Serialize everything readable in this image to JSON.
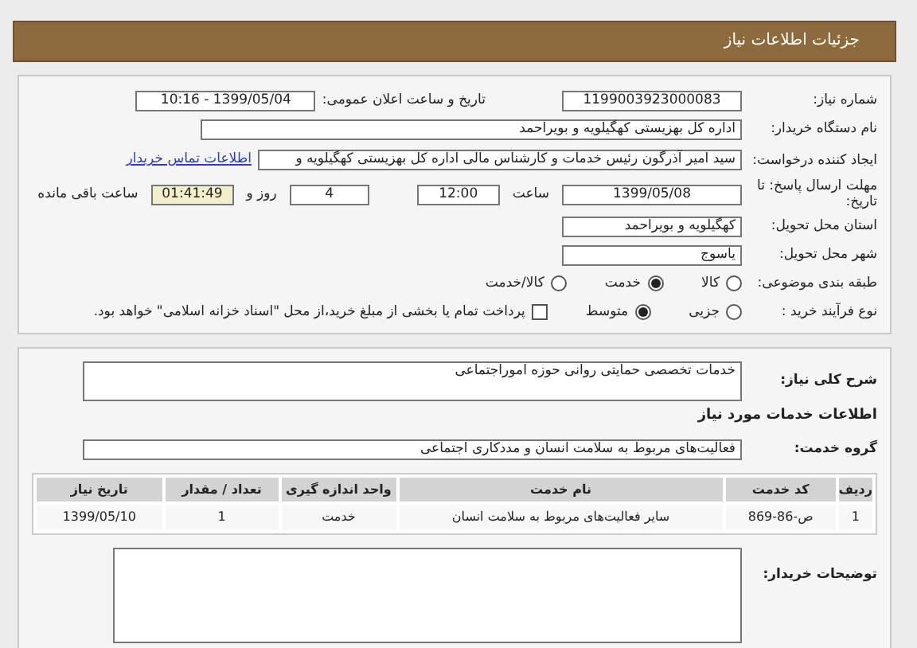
{
  "header": {
    "title": "جزئیات اطلاعات نیاز"
  },
  "need_number": {
    "label": "شماره نیاز:",
    "value": "1199003923000083"
  },
  "announce": {
    "label": "تاریخ و ساعت اعلان عمومی:",
    "value": "1399/05/04 - 10:16"
  },
  "buyer": {
    "label": "نام دستگاه خریدار:",
    "value": "اداره کل بهزیستی کهگیلویه و بویراحمد"
  },
  "creator": {
    "label": "ایجاد کننده درخواست:",
    "value": "سید امیر آذرگون رئیس خدمات و کارشناس مالی اداره کل بهزیستی کهگیلویه و",
    "link": "اطلاعات تماس خریدار"
  },
  "deadline": {
    "label": "مهلت ارسال پاسخ: تا تاریخ:",
    "date": "1399/05/08",
    "time_label": "ساعت",
    "time": "12:00",
    "days": "4",
    "days_label": "روز و",
    "remaining": "01:41:49",
    "remaining_label": "ساعت باقی مانده"
  },
  "province": {
    "label": "استان محل تحویل:",
    "value": "کهگیلویه و بویراحمد"
  },
  "city": {
    "label": "شهر محل تحویل:",
    "value": "یاسوج"
  },
  "category": {
    "label": "طبقه بندی موضوعی:",
    "options": [
      {
        "label": "کالا",
        "selected": false
      },
      {
        "label": "خدمت",
        "selected": true
      },
      {
        "label": "کالا/خدمت",
        "selected": false
      }
    ]
  },
  "purchase_type": {
    "label": "نوع فرآیند خرید :",
    "options": [
      {
        "label": "جزیی",
        "selected": false
      },
      {
        "label": "متوسط",
        "selected": true
      }
    ],
    "treasury": {
      "label": "پرداخت تمام یا بخشی از مبلغ خرید،از محل \"اسناد خزانه اسلامی\" خواهد بود.",
      "checked": false
    }
  },
  "description": {
    "label": "شرح کلی نیاز:",
    "value": "خدمات تخصصی حمایتی روانی حوزه اموراجتماعی"
  },
  "services_heading": "اطلاعات خدمات مورد نیاز",
  "service_group": {
    "label": "گروه خدمت:",
    "value": "فعالیت‌های مربوط به سلامت انسان و مددکاری اجتماعی"
  },
  "table": {
    "columns": [
      "ردیف",
      "کد خدمت",
      "نام خدمت",
      "واحد اندازه گیری",
      "تعداد / مقدار",
      "تاریخ نیاز"
    ],
    "rows": [
      [
        "1",
        "ص-86-869",
        "سایر فعالیت‌های مربوط به سلامت انسان",
        "خدمت",
        "1",
        "1399/05/10"
      ]
    ]
  },
  "buyer_notes": {
    "label": "توضیحات خریدار:"
  }
}
